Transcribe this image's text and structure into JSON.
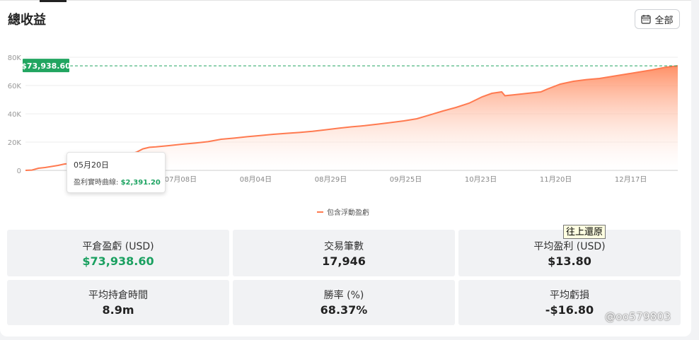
{
  "header": {
    "title": "總收益",
    "range_button_label": "全部"
  },
  "chart_data": {
    "type": "area",
    "title": "總收益",
    "ylim": [
      0,
      80000
    ],
    "y_ticks": [
      "0",
      "20K",
      "40K",
      "60K",
      "80K"
    ],
    "x_ticks": [
      "07月08日",
      "08月04日",
      "08月29日",
      "09月25日",
      "10月23日",
      "11月20日",
      "12月17日"
    ],
    "current_value_label": "$73,938.60",
    "legend": [
      "包含浮動盈虧"
    ],
    "grid": true,
    "colors": {
      "line": "#ff7a50",
      "fill_top": "#ff8a5e",
      "label_bg": "#21a560",
      "guide": "#21a560"
    },
    "series": [
      {
        "name": "包含浮動盈虧",
        "points": [
          [
            0,
            0
          ],
          [
            0.01,
            200
          ],
          [
            0.02,
            1500
          ],
          [
            0.03,
            2000
          ],
          [
            0.05,
            3500
          ],
          [
            0.06,
            4500
          ],
          [
            0.08,
            5200
          ],
          [
            0.1,
            6500
          ],
          [
            0.12,
            7800
          ],
          [
            0.14,
            9500
          ],
          [
            0.15,
            10800
          ],
          [
            0.16,
            11600
          ],
          [
            0.17,
            12800
          ],
          [
            0.18,
            15200
          ],
          [
            0.19,
            16300
          ],
          [
            0.2,
            16600
          ],
          [
            0.22,
            17500
          ],
          [
            0.24,
            18500
          ],
          [
            0.26,
            19300
          ],
          [
            0.28,
            20300
          ],
          [
            0.3,
            22000
          ],
          [
            0.32,
            22800
          ],
          [
            0.34,
            23800
          ],
          [
            0.36,
            24600
          ],
          [
            0.38,
            25500
          ],
          [
            0.4,
            26200
          ],
          [
            0.42,
            26800
          ],
          [
            0.44,
            27600
          ],
          [
            0.46,
            28700
          ],
          [
            0.48,
            29800
          ],
          [
            0.5,
            30800
          ],
          [
            0.52,
            31600
          ],
          [
            0.54,
            32700
          ],
          [
            0.56,
            33800
          ],
          [
            0.58,
            35000
          ],
          [
            0.6,
            36500
          ],
          [
            0.62,
            39200
          ],
          [
            0.64,
            42000
          ],
          [
            0.66,
            44500
          ],
          [
            0.68,
            47500
          ],
          [
            0.7,
            52000
          ],
          [
            0.715,
            54500
          ],
          [
            0.73,
            55500
          ],
          [
            0.735,
            52800
          ],
          [
            0.75,
            53500
          ],
          [
            0.77,
            54500
          ],
          [
            0.79,
            55500
          ],
          [
            0.8,
            57500
          ],
          [
            0.82,
            61000
          ],
          [
            0.84,
            63000
          ],
          [
            0.86,
            64200
          ],
          [
            0.88,
            65000
          ],
          [
            0.9,
            66500
          ],
          [
            0.92,
            68000
          ],
          [
            0.94,
            69500
          ],
          [
            0.96,
            71000
          ],
          [
            0.98,
            72800
          ],
          [
            1,
            73938.6
          ]
        ]
      }
    ],
    "tooltip": {
      "date": "05月20日",
      "label": "盈利實時曲線:",
      "value": "$2,391.20"
    }
  },
  "stats": [
    {
      "label": "平倉盈虧 (USD)",
      "value": "$73,938.60",
      "accent": true
    },
    {
      "label": "交易筆數",
      "value": "17,946",
      "accent": false
    },
    {
      "label": "平均盈利 (USD)",
      "value": "$13.80",
      "accent": false
    },
    {
      "label": "平均持倉時間",
      "value": "8.9m",
      "accent": false
    },
    {
      "label": "勝率 (%)",
      "value": "68.37%",
      "accent": false
    },
    {
      "label": "平均虧損",
      "value": "-$16.80",
      "accent": false
    }
  ],
  "overlay": {
    "native_tooltip": "往上還原",
    "watermark": "@oo579803"
  }
}
